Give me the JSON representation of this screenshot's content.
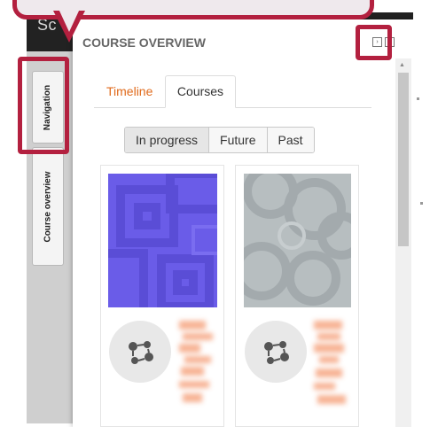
{
  "topbar": {
    "text": "Sc"
  },
  "sidebar": {
    "items": [
      {
        "label": "Navigation"
      },
      {
        "label": "Course overview"
      }
    ]
  },
  "block": {
    "title": "COURSE OVERVIEW",
    "icons": [
      "dock-icon",
      "move-icon"
    ]
  },
  "tabs": [
    {
      "label": "Timeline",
      "active": false
    },
    {
      "label": "Courses",
      "active": true
    }
  ],
  "filters": [
    {
      "label": "In progress",
      "active": true
    },
    {
      "label": "Future",
      "active": false
    },
    {
      "label": "Past",
      "active": false
    }
  ],
  "colors": {
    "highlight": "#b3203f",
    "tab_link": "#e06a1b",
    "course1_image": "#6a5ce8",
    "course2_image": "#b7bec0",
    "redacted_text": "#f5a07a"
  },
  "courses": [
    {
      "image": "purple-squares-pattern",
      "icon": "course-icon"
    },
    {
      "image": "grey-circles-pattern",
      "icon": "course-icon"
    }
  ]
}
